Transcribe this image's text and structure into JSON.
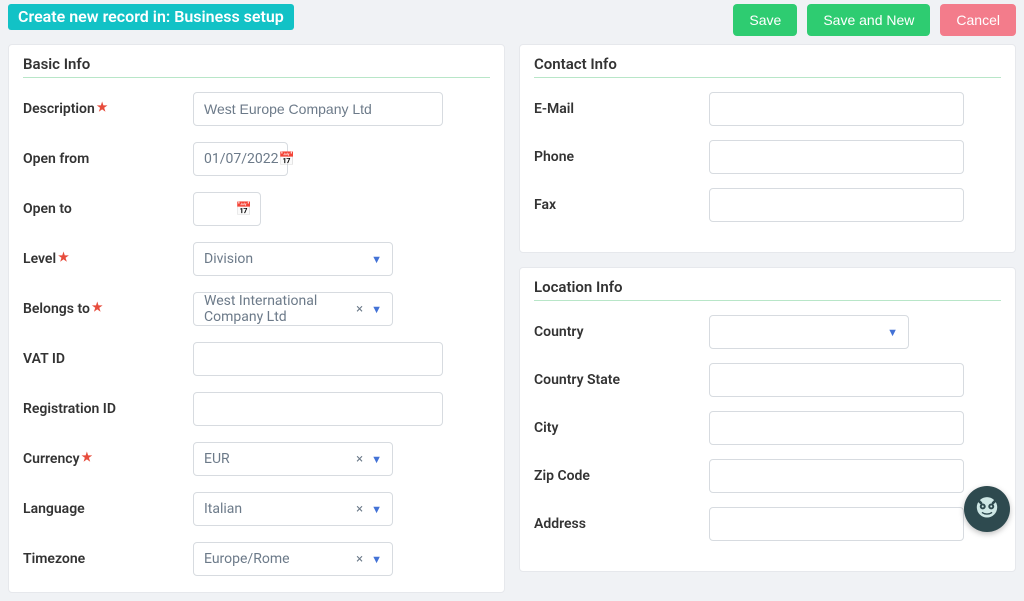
{
  "header": {
    "title": "Create new record in: Business setup",
    "buttons": {
      "save": "Save",
      "save_new": "Save and New",
      "cancel": "Cancel"
    }
  },
  "panels": {
    "basic": {
      "title": "Basic Info",
      "fields": {
        "description": {
          "label": "Description",
          "value": "West Europe Company Ltd"
        },
        "open_from": {
          "label": "Open from",
          "value": "01/07/2022"
        },
        "open_to": {
          "label": "Open to",
          "value": ""
        },
        "level": {
          "label": "Level",
          "value": "Division"
        },
        "belongs_to": {
          "label": "Belongs to",
          "value": "West International Company Ltd"
        },
        "vat_id": {
          "label": "VAT ID",
          "value": ""
        },
        "reg_id": {
          "label": "Registration ID",
          "value": ""
        },
        "currency": {
          "label": "Currency",
          "value": "EUR"
        },
        "language": {
          "label": "Language",
          "value": "Italian"
        },
        "timezone": {
          "label": "Timezone",
          "value": "Europe/Rome"
        }
      }
    },
    "contact": {
      "title": "Contact Info",
      "fields": {
        "email": {
          "label": "E-Mail",
          "value": ""
        },
        "phone": {
          "label": "Phone",
          "value": ""
        },
        "fax": {
          "label": "Fax",
          "value": ""
        }
      }
    },
    "location": {
      "title": "Location Info",
      "fields": {
        "country": {
          "label": "Country",
          "value": ""
        },
        "country_state": {
          "label": "Country State",
          "value": ""
        },
        "city": {
          "label": "City",
          "value": ""
        },
        "zip": {
          "label": "Zip Code",
          "value": ""
        },
        "address": {
          "label": "Address",
          "value": ""
        }
      }
    }
  }
}
